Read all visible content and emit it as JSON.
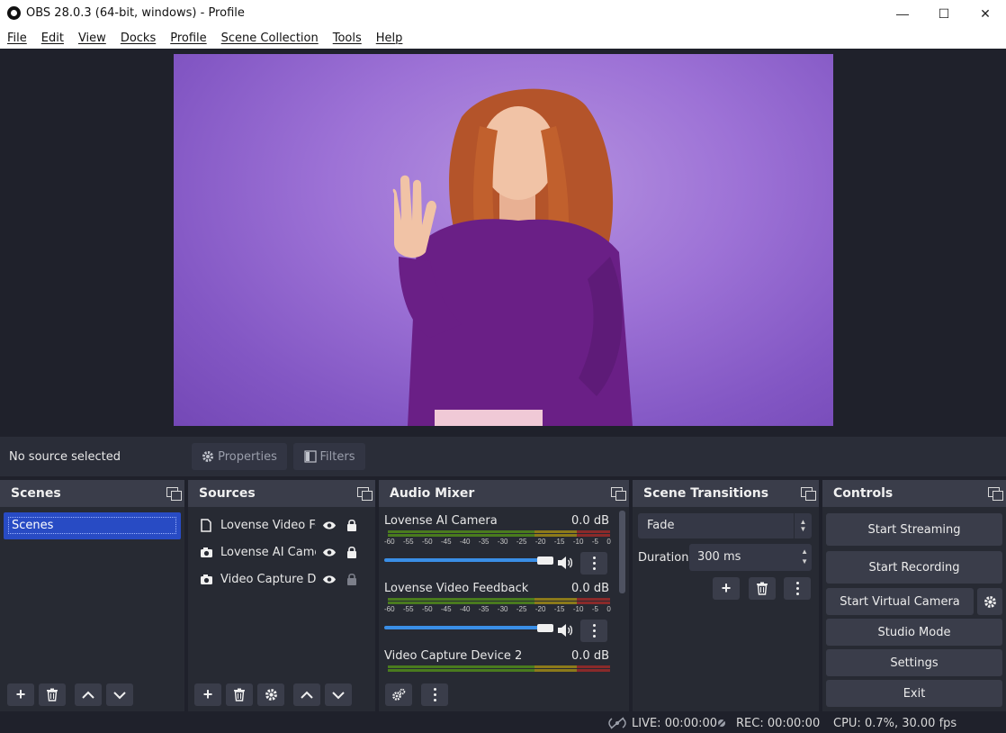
{
  "window": {
    "title": "OBS 28.0.3 (64-bit, windows) - Profile",
    "minimize": "—",
    "maximize": "☐",
    "close": "✕"
  },
  "menu": [
    "File",
    "Edit",
    "View",
    "Docks",
    "Profile",
    "Scene Collection",
    "Tools",
    "Help"
  ],
  "source_toolbar": {
    "no_source": "No source selected",
    "properties": "Properties",
    "filters": "Filters"
  },
  "scenes": {
    "title": "Scenes",
    "items": [
      "Scenes"
    ]
  },
  "sources": {
    "title": "Sources",
    "items": [
      {
        "label": "Lovense Video Fe",
        "icon": "file-icon",
        "visible": true,
        "locked": true
      },
      {
        "label": "Lovense AI Camer",
        "icon": "camera-icon",
        "visible": true,
        "locked": true
      },
      {
        "label": "Video Capture De",
        "icon": "camera-icon",
        "visible": true,
        "locked": false
      }
    ]
  },
  "audio_mixer": {
    "title": "Audio Mixer",
    "ticks": [
      "-60",
      "-55",
      "-50",
      "-45",
      "-40",
      "-35",
      "-30",
      "-25",
      "-20",
      "-15",
      "-10",
      "-5",
      "0"
    ],
    "channels": [
      {
        "name": "Lovense AI Camera",
        "db": "0.0 dB",
        "volume": 1.0
      },
      {
        "name": "Lovense Video Feedback",
        "db": "0.0 dB",
        "volume": 1.0
      },
      {
        "name": "Video Capture Device 2",
        "db": "0.0 dB",
        "volume": 1.0
      }
    ]
  },
  "scene_transitions": {
    "title": "Scene Transitions",
    "transition": "Fade",
    "duration_label": "Duration",
    "duration_value": "300 ms"
  },
  "controls": {
    "title": "Controls",
    "start_streaming": "Start Streaming",
    "start_recording": "Start Recording",
    "start_virtual_camera": "Start Virtual Camera",
    "studio_mode": "Studio Mode",
    "settings": "Settings",
    "exit": "Exit"
  },
  "status": {
    "live": "LIVE: 00:00:00",
    "rec": "REC: 00:00:00",
    "cpu": "CPU: 0.7%, 30.00 fps"
  },
  "colors": {
    "accent": "#284bc4",
    "panel": "#272a33",
    "header": "#3a3d4a",
    "preview_bg": "#9d72d6"
  }
}
